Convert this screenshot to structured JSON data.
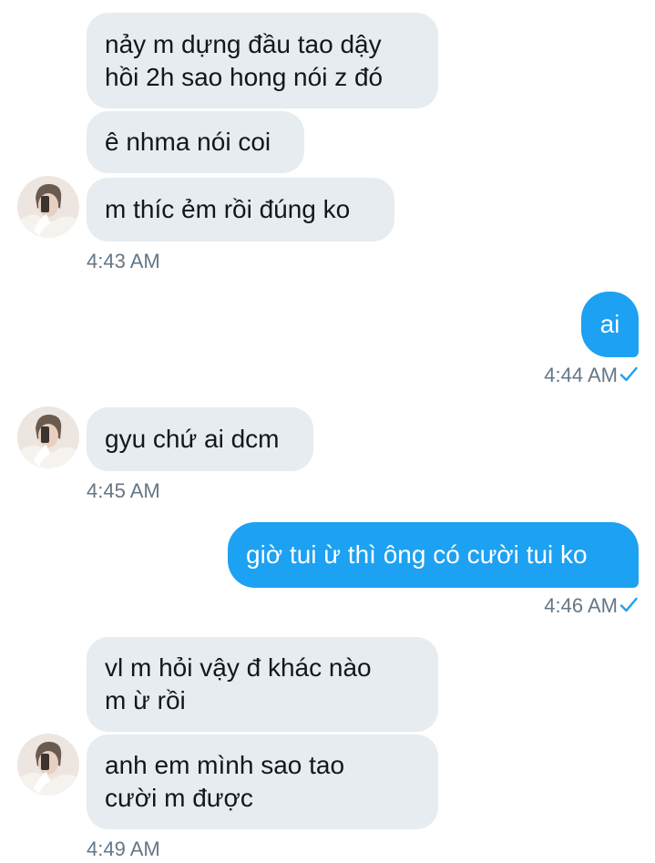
{
  "messages": [
    {
      "direction": "incoming",
      "text": "nảy m dựng đầu tao dậy\nhồi 2h sao hong nói z đó"
    },
    {
      "direction": "incoming",
      "text": "ê nhma nói coi"
    },
    {
      "direction": "incoming",
      "text": "m thíc ẻm rồi đúng ko"
    },
    {
      "direction": "outgoing",
      "text": "ai"
    },
    {
      "direction": "incoming",
      "text": "gyu chứ ai dcm"
    },
    {
      "direction": "outgoing",
      "text": "giờ tui ừ thì ông có cười tui ko"
    },
    {
      "direction": "incoming",
      "text": "vl m hỏi vậy đ khác nào\nm ừ rồi"
    },
    {
      "direction": "incoming",
      "text": "anh em mình sao tao\ncười m được"
    }
  ],
  "timestamps": [
    "4:43 AM",
    "4:44 AM",
    "4:45 AM",
    "4:46 AM",
    "4:49 AM"
  ],
  "icons": {
    "read_receipt": "checkmark-icon",
    "sender": "avatar"
  },
  "colors": {
    "incoming_bubble": "#e6ecf0",
    "outgoing_bubble": "#1da1f2",
    "timestamp": "#657786",
    "checkmark": "#1da1f2"
  }
}
